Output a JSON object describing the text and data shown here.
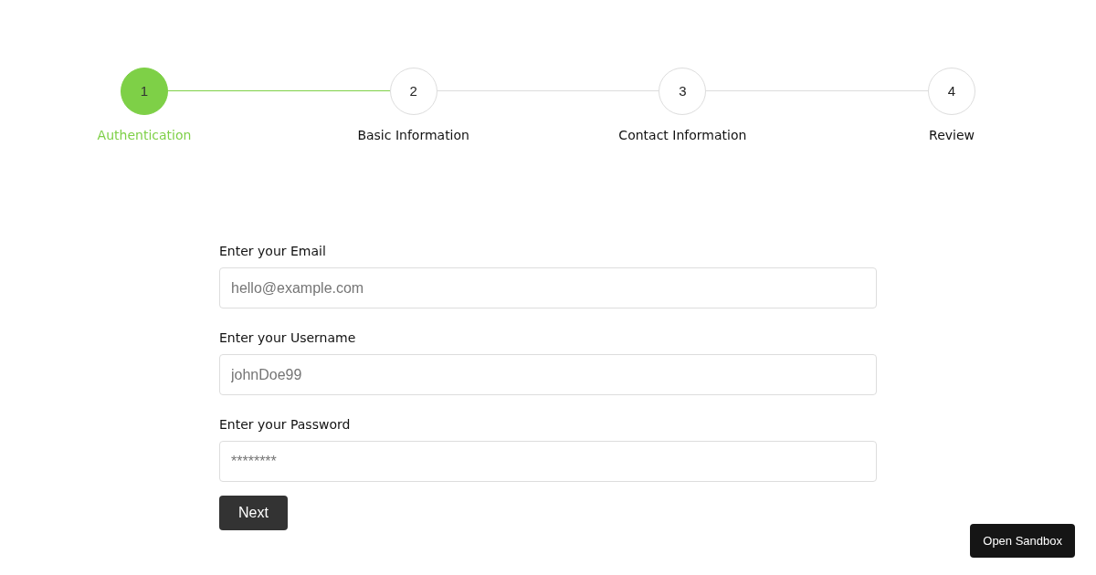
{
  "steps": [
    {
      "number": "1",
      "label": "Authentication",
      "selected": true
    },
    {
      "number": "2",
      "label": "Basic Information",
      "selected": false
    },
    {
      "number": "3",
      "label": "Contact Information",
      "selected": false
    },
    {
      "number": "4",
      "label": "Review",
      "selected": false
    }
  ],
  "fields": [
    {
      "label": "Enter your Email",
      "placeholder": "hello@example.com"
    },
    {
      "label": "Enter your Username",
      "placeholder": "johnDoe99"
    },
    {
      "label": "Enter your Password",
      "placeholder": "********"
    }
  ],
  "next_button": "Next",
  "sandbox_button": "Open Sandbox"
}
